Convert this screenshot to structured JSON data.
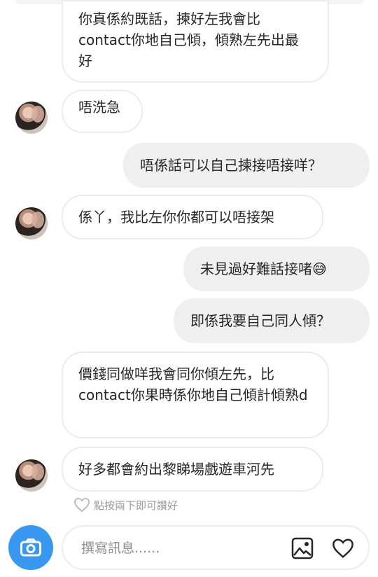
{
  "messages": [
    {
      "side": "received",
      "text": "你真係約既話，揀好左我會比contact你地自己傾，傾熟左先出最好",
      "avatar": false
    },
    {
      "side": "received",
      "text": "唔洗急",
      "avatar": true
    },
    {
      "side": "sent",
      "text": "唔係話可以自己揀接唔接咩？"
    },
    {
      "side": "received",
      "text": "係丫，我比左你你都可以唔接架",
      "avatar": true
    },
    {
      "side": "sent",
      "text": "未見過好難話接啫😅"
    },
    {
      "side": "sent",
      "text": "即係我要自己同人傾？"
    },
    {
      "side": "received",
      "text": "價錢同做咩我會同你傾左先，比contact你果時係你地自己傾計傾熟d",
      "avatar": false
    },
    {
      "side": "received",
      "text": "好多都會約出黎睇場戲遊車河先",
      "avatar": true
    }
  ],
  "like_hint": "點按兩下即可讚好",
  "composer": {
    "placeholder": "撰寫訊息......",
    "camera_icon": "camera-icon",
    "gallery_icon": "image-icon",
    "like_icon": "heart-icon"
  },
  "colors": {
    "accent": "#3897f0",
    "sent_bubble": "#efefef",
    "received_border": "#ececec",
    "hint_text": "#9a9a9a"
  }
}
